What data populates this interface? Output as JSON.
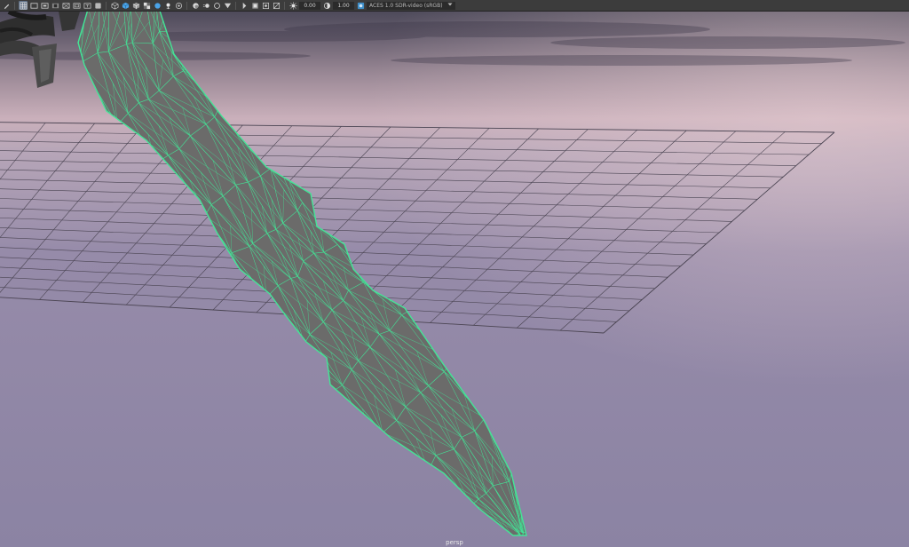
{
  "toolbar": {
    "exposure_value": "0.00",
    "gamma_value": "1.00",
    "color_space": "ACES 1.0 SDR-video (sRGB)",
    "icons": [
      "select-camera-icon",
      "camera-attributes-icon",
      "bookmark-icon",
      "image-plane-icon",
      "grid-icon",
      "film-gate-icon",
      "resolution-gate-icon",
      "gate-mask-icon",
      "field-chart-icon",
      "safe-action-icon",
      "safe-title-icon",
      "pan-zoom-icon",
      "grease-pencil-icon",
      "wireframe-icon",
      "smooth-shade-icon",
      "use-default-material-icon",
      "wireframe-on-shaded-icon",
      "textured-icon",
      "use-all-lights-icon",
      "shadows-icon",
      "screen-space-ao-icon",
      "motion-blur-icon",
      "multisample-aa-icon",
      "depth-of-field-icon",
      "isolate-select-icon",
      "xray-icon",
      "xray-joints-icon",
      "backface-culling-icon"
    ]
  },
  "colors": {
    "wireframe": "#43e597",
    "mesh": "#6b6b6a",
    "grid": "#4a4452",
    "sky_top": "#4d4a5a",
    "horizon": "#cab0bb",
    "ground": "#8b83a3"
  },
  "viewport": {
    "camera_name": "persp"
  }
}
